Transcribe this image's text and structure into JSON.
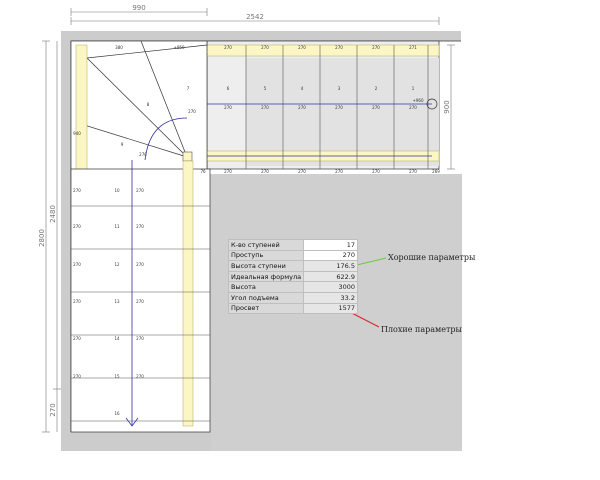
{
  "dimensions": {
    "top_short": "990",
    "top_long": "2542",
    "left_total": "2800",
    "left_flight": "2480",
    "left_bottom": "270",
    "right_end": "900"
  },
  "plan": {
    "top_row": [
      "380",
      "+950",
      "270",
      "270",
      "270",
      "270",
      "270",
      "271"
    ],
    "top_step_numbers": [
      "8",
      "7",
      "6",
      "5",
      "4",
      "3",
      "2",
      "1"
    ],
    "mid_row": [
      "270",
      "270",
      "270",
      "270",
      "270",
      "270",
      "+960"
    ],
    "bottom_row": [
      "270",
      "270",
      "270",
      "270",
      "270",
      "270",
      "269"
    ],
    "left_marks": [
      "940",
      "270",
      "270",
      "270",
      "270",
      "270",
      "270"
    ],
    "right_marks": [
      "270",
      "270",
      "270",
      "270",
      "270",
      "270"
    ],
    "winder_numbers": [
      "9",
      "8"
    ],
    "flight_numbers": [
      "10",
      "11",
      "12",
      "13",
      "14",
      "15",
      "16"
    ],
    "winder_labels": [
      "270",
      "270"
    ],
    "corner_mark": "76"
  },
  "params_table": {
    "rows": [
      {
        "name": "К-во ступеней",
        "value": "17"
      },
      {
        "name": "Проступь",
        "value": "270"
      },
      {
        "name": "Высота ступени",
        "value": "176.5"
      },
      {
        "name": "Идеальная формула",
        "value": "622.9"
      },
      {
        "name": "Высота",
        "value": "3000"
      },
      {
        "name": "Угол подъема",
        "value": "33.2"
      },
      {
        "name": "Просвет",
        "value": "1577"
      }
    ]
  },
  "annotations": {
    "good": "Хорошие параметры",
    "bad": "Плохие параметры"
  },
  "colors": {
    "good_marker": "#66cc33",
    "bad_marker": "#dd2222",
    "stringer": "#fbf6c4",
    "wall": "#cccccc",
    "blue_line": "#3030a0"
  }
}
